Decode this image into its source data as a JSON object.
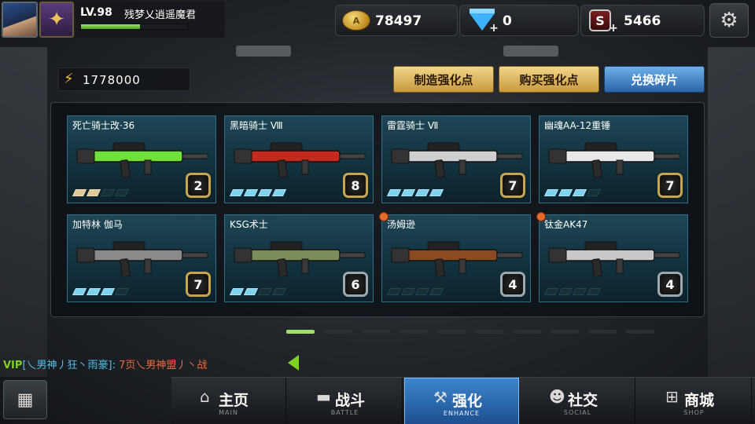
{
  "player": {
    "level": "LV.98",
    "name": "残梦乂逍遥魔君",
    "xp_progress": 0.55
  },
  "resources": {
    "gold": "78497",
    "diamonds": "0",
    "s_coins": "5466"
  },
  "energy": "1778000",
  "actions": {
    "make_points": "制造强化点",
    "buy_points": "购买强化点",
    "exchange_fragments": "兑换碎片"
  },
  "weapons": [
    {
      "name": "死亡骑士改·36",
      "grade": "2",
      "pips_on": 2,
      "pip_style": "gold",
      "frame": "gold",
      "new": false
    },
    {
      "name": "黑暗骑士 Ⅷ",
      "grade": "8",
      "pips_on": 4,
      "pip_style": "blue",
      "frame": "gold",
      "new": false
    },
    {
      "name": "雷霆骑士 Ⅶ",
      "grade": "7",
      "pips_on": 4,
      "pip_style": "blue",
      "frame": "gold",
      "new": false
    },
    {
      "name": "幽魂AA-12重锤",
      "grade": "7",
      "pips_on": 3,
      "pip_style": "blue",
      "frame": "gold",
      "new": false
    },
    {
      "name": "加特林 伽马",
      "grade": "7",
      "pips_on": 3,
      "pip_style": "blue",
      "frame": "gold",
      "new": false
    },
    {
      "name": "KSG术士",
      "grade": "6",
      "pips_on": 2,
      "pip_style": "blue",
      "frame": "silver",
      "new": false
    },
    {
      "name": "汤姆逊",
      "grade": "4",
      "pips_on": 0,
      "pip_style": "blue",
      "frame": "silver",
      "new": true
    },
    {
      "name": "钛金AK47",
      "grade": "4",
      "pips_on": 0,
      "pip_style": "blue",
      "frame": "silver",
      "new": true
    }
  ],
  "pager": {
    "pages": 10,
    "current": 1
  },
  "chat": {
    "vip": "VIP",
    "sender": "[乀男神丿狂丶雨豪]:",
    "message": "7页乀男神盟丿丶战"
  },
  "nav": {
    "tabs": [
      {
        "label": "主页",
        "sub": "MAIN",
        "icon": "home-icon"
      },
      {
        "label": "战斗",
        "sub": "BATTLE",
        "icon": "pistol-icon"
      },
      {
        "label": "强化",
        "sub": "ENHANCE",
        "icon": "hammer-icon"
      },
      {
        "label": "社交",
        "sub": "SOCIAL",
        "icon": "people-icon"
      },
      {
        "label": "商城",
        "sub": "SHOP",
        "icon": "cart-icon"
      }
    ],
    "active": 2
  },
  "colors": {
    "accent_blue": "#3c86cf",
    "gold": "#c8a44a",
    "xp_green": "#7ed321",
    "chat_sender": "#4fc1e9",
    "chat_message": "#f06a3c"
  }
}
